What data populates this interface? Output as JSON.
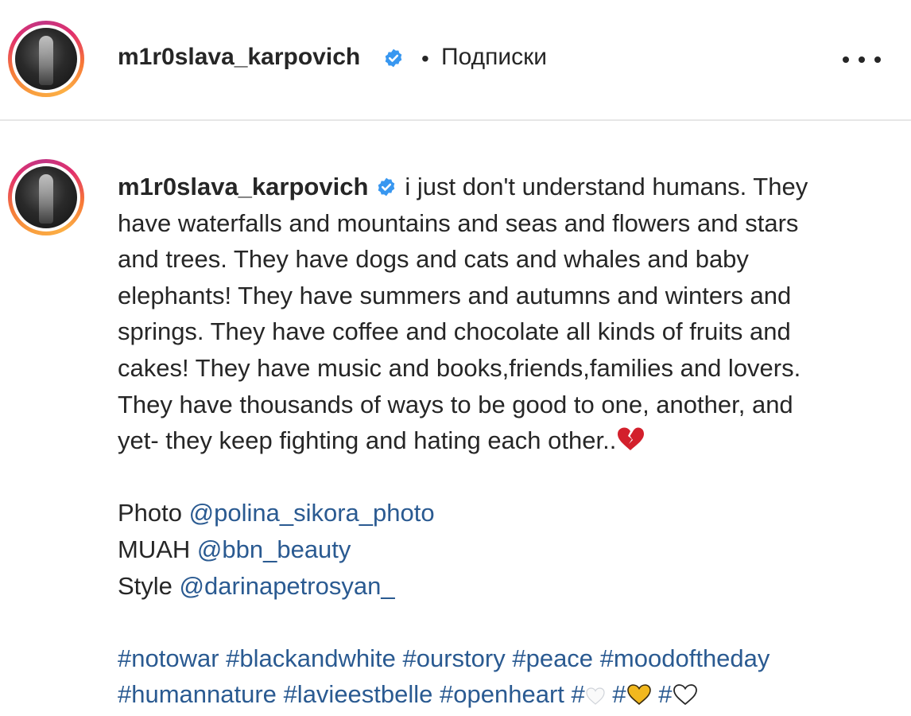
{
  "header": {
    "username": "m1r0slava_karpovich",
    "separator": "•",
    "follow_status": "Подписки",
    "more_icon": "more-horizontal-icon"
  },
  "caption": {
    "username": "m1r0slava_karpovich",
    "text_lines": [
      "i just don't understand humans. They",
      "have waterfalls and mountains and seas and flowers and stars",
      "and trees. They have dogs and cats and whales and baby",
      "elephants! They have summers and autumns and winters and",
      "springs. They have coffee and chocolate all kinds of fruits and",
      "cakes! They have music and books,friends,families and lovers.",
      "They have thousands of ways to be good to one, another, and",
      "yet- they keep fighting and hating each other.."
    ],
    "broken_heart_icon": "broken-heart-icon",
    "credits": [
      {
        "label": "Photo",
        "handle": "@polina_sikora_photo"
      },
      {
        "label": "MUAH",
        "handle": "@bbn_beauty"
      },
      {
        "label": "Style",
        "handle": "@darinapetrosyan_"
      }
    ],
    "hashtags_line1": [
      "#notowar",
      "#blackandwhite",
      "#ourstory",
      "#peace",
      "#moodoftheday"
    ],
    "hashtags_line2": [
      "#humannature",
      "#lavieestbelle",
      "#openheart"
    ],
    "hash": "#",
    "emoji_tags": [
      "white-heart-outline-icon",
      "yellow-heart-icon",
      "white-heart-icon"
    ]
  },
  "colors": {
    "link": "#2a5a91",
    "verified": "#3897f0",
    "text": "#262626",
    "divider": "#e6e6e6"
  }
}
